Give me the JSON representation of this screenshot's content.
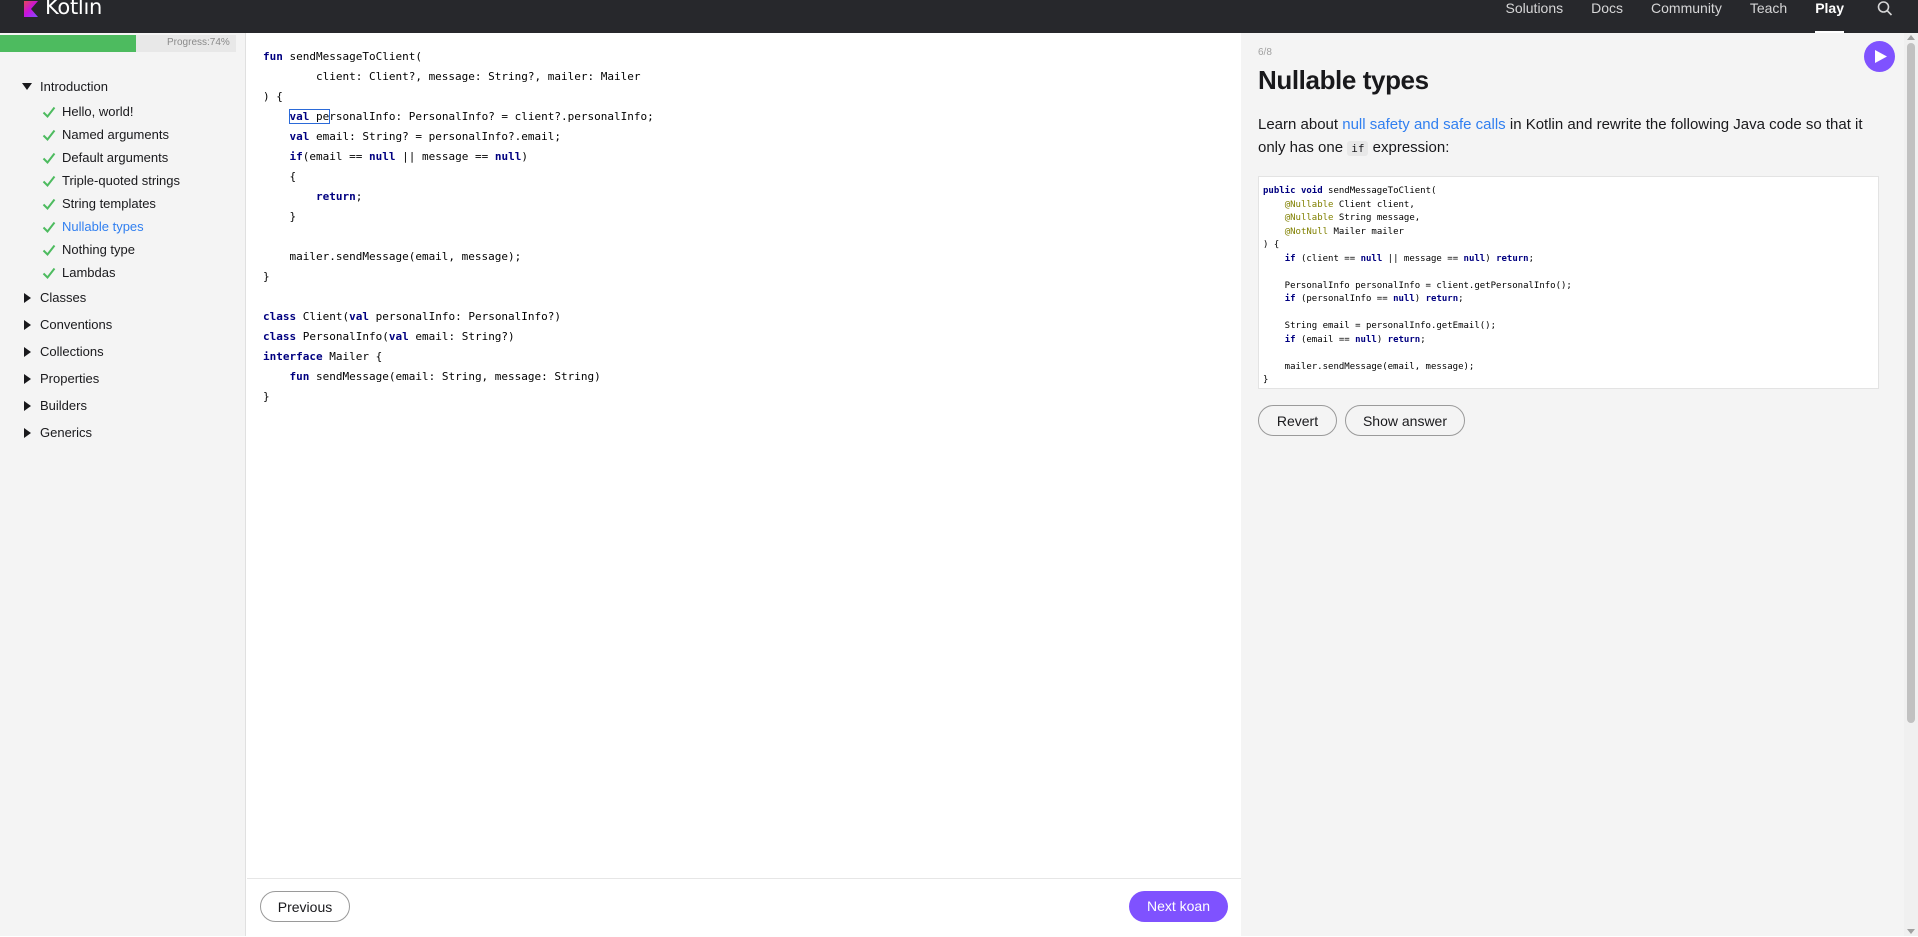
{
  "topnav": {
    "logo": "Kotlin",
    "items": [
      "Solutions",
      "Docs",
      "Community",
      "Teach",
      "Play"
    ],
    "active": "Play"
  },
  "sidebar": {
    "progress": {
      "label": "Progress:74%",
      "percent": 74
    },
    "sections": [
      {
        "label": "Introduction",
        "expanded": true,
        "items": [
          {
            "label": "Hello, world!",
            "done": true
          },
          {
            "label": "Named arguments",
            "done": true
          },
          {
            "label": "Default arguments",
            "done": true
          },
          {
            "label": "Triple-quoted strings",
            "done": true
          },
          {
            "label": "String templates",
            "done": true
          },
          {
            "label": "Nullable types",
            "done": true,
            "active": true
          },
          {
            "label": "Nothing type",
            "done": true
          },
          {
            "label": "Lambdas",
            "done": true
          }
        ]
      },
      {
        "label": "Classes",
        "expanded": false
      },
      {
        "label": "Conventions",
        "expanded": false
      },
      {
        "label": "Collections",
        "expanded": false
      },
      {
        "label": "Properties",
        "expanded": false
      },
      {
        "label": "Builders",
        "expanded": false
      },
      {
        "label": "Generics",
        "expanded": false
      }
    ]
  },
  "editor": {
    "code_lines": [
      "fun sendMessageToClient(",
      "        client: Client?, message: String?, mailer: Mailer",
      ") {",
      "    val personalInfo: PersonalInfo? = client?.personalInfo;",
      "    val email: String? = personalInfo?.email;",
      "    if(email == null || message == null)",
      "    {",
      "        return;",
      "    }",
      "",
      "    mailer.sendMessage(email, message);",
      "}",
      "",
      "class Client(val personalInfo: PersonalInfo?)",
      "class PersonalInfo(val email: String?)",
      "interface Mailer {",
      "    fun sendMessage(email: String, message: String)",
      "}"
    ],
    "keywords": [
      "fun",
      "val",
      "if",
      "null",
      "return",
      "class",
      "interface"
    ]
  },
  "footer": {
    "prev_label": "Previous",
    "next_label": "Next koan"
  },
  "panel": {
    "counter": "6/8",
    "title": "Nullable types",
    "desc_pre": "Learn about ",
    "desc_link": "null safety and safe calls",
    "desc_mid": " in Kotlin and rewrite the following Java code so that it only has one ",
    "desc_code": "if",
    "desc_post": " expression:",
    "java_lines": [
      "public void sendMessageToClient(",
      "    @Nullable Client client,",
      "    @Nullable String message,",
      "    @NotNull Mailer mailer",
      ") {",
      "    if (client == null || message == null) return;",
      "",
      "    PersonalInfo personalInfo = client.getPersonalInfo();",
      "    if (personalInfo == null) return;",
      "",
      "    String email = personalInfo.getEmail();",
      "    if (email == null) return;",
      "",
      "    mailer.sendMessage(email, message);",
      "}"
    ],
    "java_keywords": [
      "public",
      "void",
      "if",
      "null",
      "return"
    ],
    "java_annotations": [
      "@Nullable",
      "@NotNull"
    ],
    "revert_label": "Revert",
    "answer_label": "Show answer"
  },
  "colors": {
    "accent": "#7f52ff",
    "link": "#307ff0",
    "progress": "#4dbb5f",
    "topbar": "#27282c",
    "keyword": "#000080",
    "annotation": "#808000"
  }
}
